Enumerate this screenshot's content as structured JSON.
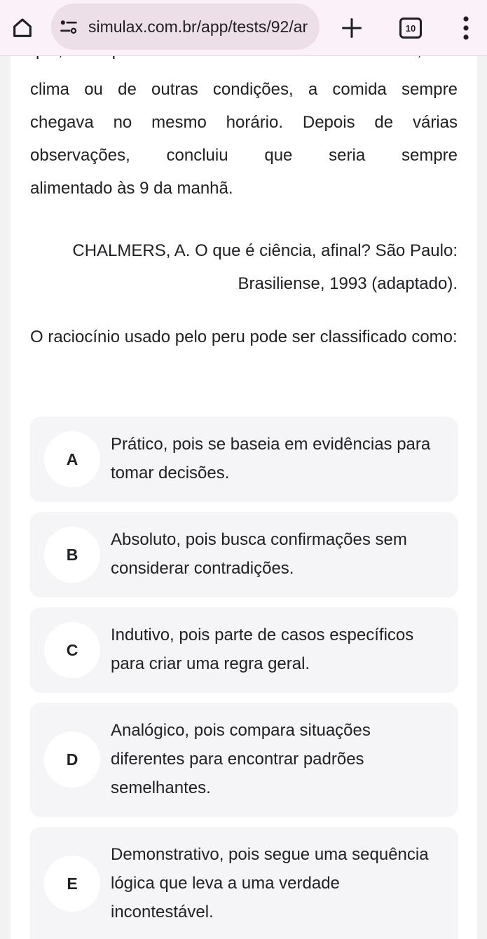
{
  "browser": {
    "url": "simulax.com.br/app/tests/92/ar",
    "tab_count": "10",
    "icons": [
      "home-icon",
      "tune-icon",
      "plus-icon",
      "tabs-icon",
      "more-vert-icon"
    ]
  },
  "passage": {
    "cut_line": "que, independentemente do dia da semana, do",
    "lines": [
      "clima ou de outras condições, a comida sempre",
      "chegava no mesmo horário. Depois de várias",
      "observações, concluiu que seria sempre",
      "alimentado às 9 da manhã."
    ]
  },
  "citation": {
    "line1": "CHALMERS, A. O que é ciência, afinal? São Paulo:",
    "line2": "Brasiliense, 1993 (adaptado)."
  },
  "question": "O raciocínio usado pelo peru pode ser classificado como:",
  "options": [
    {
      "letter": "A",
      "text": "Prático, pois se baseia em evidências para tomar decisões."
    },
    {
      "letter": "B",
      "text": "Absoluto, pois busca confirmações sem considerar contradições."
    },
    {
      "letter": "C",
      "text": "Indutivo, pois parte de casos específicos para criar uma regra geral."
    },
    {
      "letter": "D",
      "text": "Analógico, pois compara situações diferentes para encontrar padrões semelhantes."
    },
    {
      "letter": "E",
      "text": "Demonstrativo, pois segue uma sequência lógica que leva a uma verdade incontestável."
    }
  ],
  "colors": {
    "toolbar_bg": "#fbf1f8",
    "urlbar_bg": "#ecdfe8",
    "option_bg": "#f5f5f7",
    "page_bg": "#f2f2f2"
  }
}
